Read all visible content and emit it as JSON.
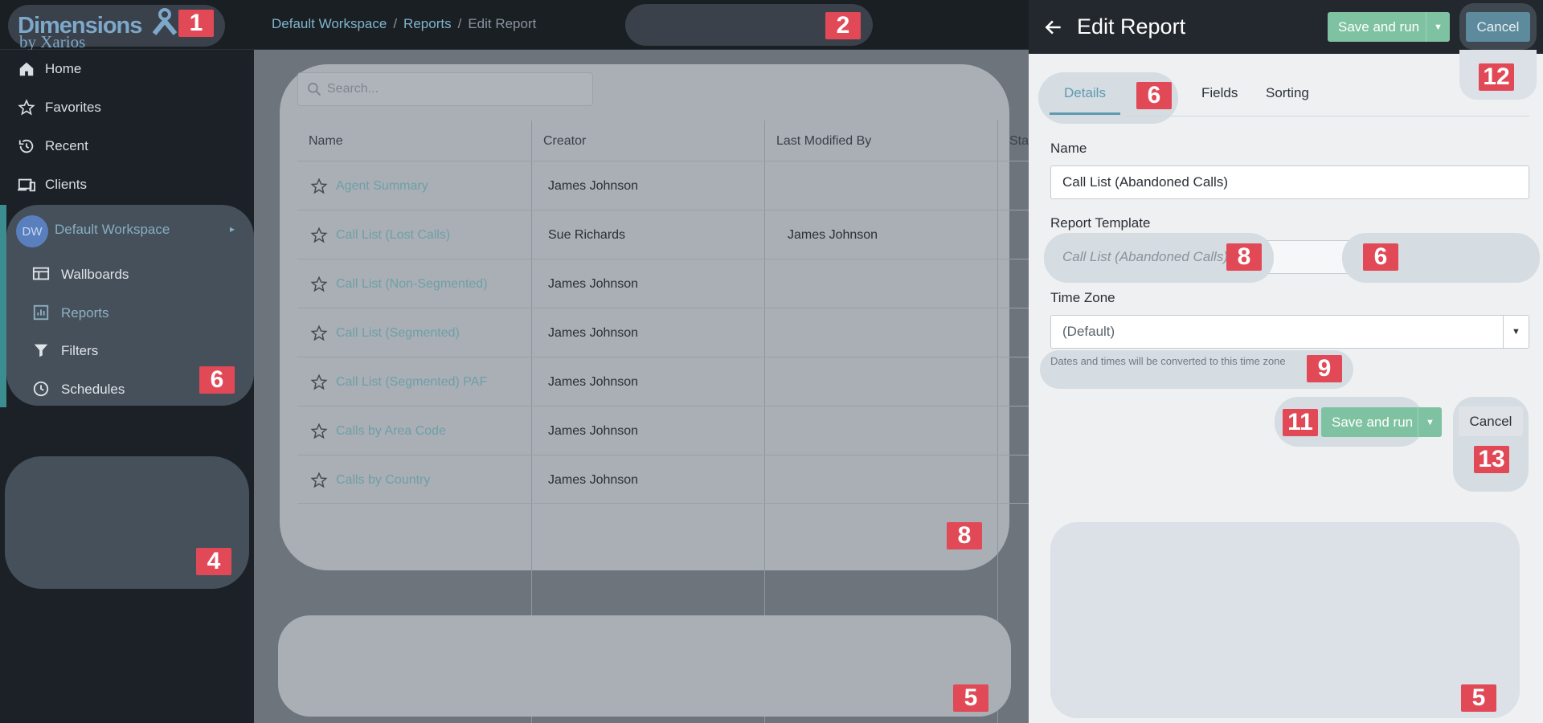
{
  "app": {
    "logo_main": "Dimensions",
    "logo_sub": "by Xarios"
  },
  "breadcrumb": {
    "items": [
      "Default Workspace",
      "Reports",
      "Edit Report"
    ],
    "separator": "/"
  },
  "sidebar": {
    "items": [
      {
        "label": "Home",
        "icon": "home-icon"
      },
      {
        "label": "Favorites",
        "icon": "star-icon"
      },
      {
        "label": "Recent",
        "icon": "history-icon"
      },
      {
        "label": "Clients",
        "icon": "devices-icon"
      }
    ],
    "workspace": {
      "avatar": "DW",
      "name": "Default Workspace",
      "items": [
        {
          "label": "Wallboards",
          "icon": "wallboard-icon"
        },
        {
          "label": "Reports",
          "icon": "chart-icon"
        },
        {
          "label": "Filters",
          "icon": "filter-icon"
        },
        {
          "label": "Schedules",
          "icon": "clock-icon"
        }
      ]
    }
  },
  "reports": {
    "search_placeholder": "Search...",
    "columns": [
      "Name",
      "Creator",
      "Last Modified By",
      "Sta"
    ],
    "rows": [
      {
        "name": "Agent Summary",
        "creator": "James Johnson",
        "modified_by": ""
      },
      {
        "name": "Call List (Lost Calls)",
        "creator": "Sue Richards",
        "modified_by": "James Johnson"
      },
      {
        "name": "Call List (Non-Segmented)",
        "creator": "James Johnson",
        "modified_by": ""
      },
      {
        "name": "Call List (Segmented)",
        "creator": "James Johnson",
        "modified_by": ""
      },
      {
        "name": "Call List (Segmented) PAF",
        "creator": "James Johnson",
        "modified_by": ""
      },
      {
        "name": "Calls by Area Code",
        "creator": "James Johnson",
        "modified_by": ""
      },
      {
        "name": "Calls by Country",
        "creator": "James Johnson",
        "modified_by": ""
      }
    ]
  },
  "edit_panel": {
    "title": "Edit Report",
    "save_run_label": "Save and run",
    "cancel_label": "Cancel",
    "tabs": [
      "Details",
      "Fields",
      "Sorting"
    ],
    "active_tab": "Details",
    "name_label": "Name",
    "name_value": "Call List (Abandoned Calls)",
    "template_label": "Report Template",
    "template_value": "Call List (Abandoned Calls)",
    "timezone_label": "Time Zone",
    "timezone_value": "(Default)",
    "timezone_hint": "Dates and times will be converted to this time zone"
  },
  "badges": {
    "logo": "1",
    "topbar": "2",
    "sidebar_empty": "4",
    "table_footer": "5",
    "panel_bottom": "5",
    "workspace": "6",
    "tab_details": "6",
    "template_right": "6",
    "table_card": "8",
    "template_field": "8",
    "hint": "9",
    "save_bottom": "11",
    "cancel_top": "12",
    "cancel_bottom": "13"
  },
  "colors": {
    "accent_teal": "#7fb4c9",
    "save_green": "#7fc2a1",
    "badge_red": "#e14957",
    "topbar_bg": "#1a1f24"
  }
}
